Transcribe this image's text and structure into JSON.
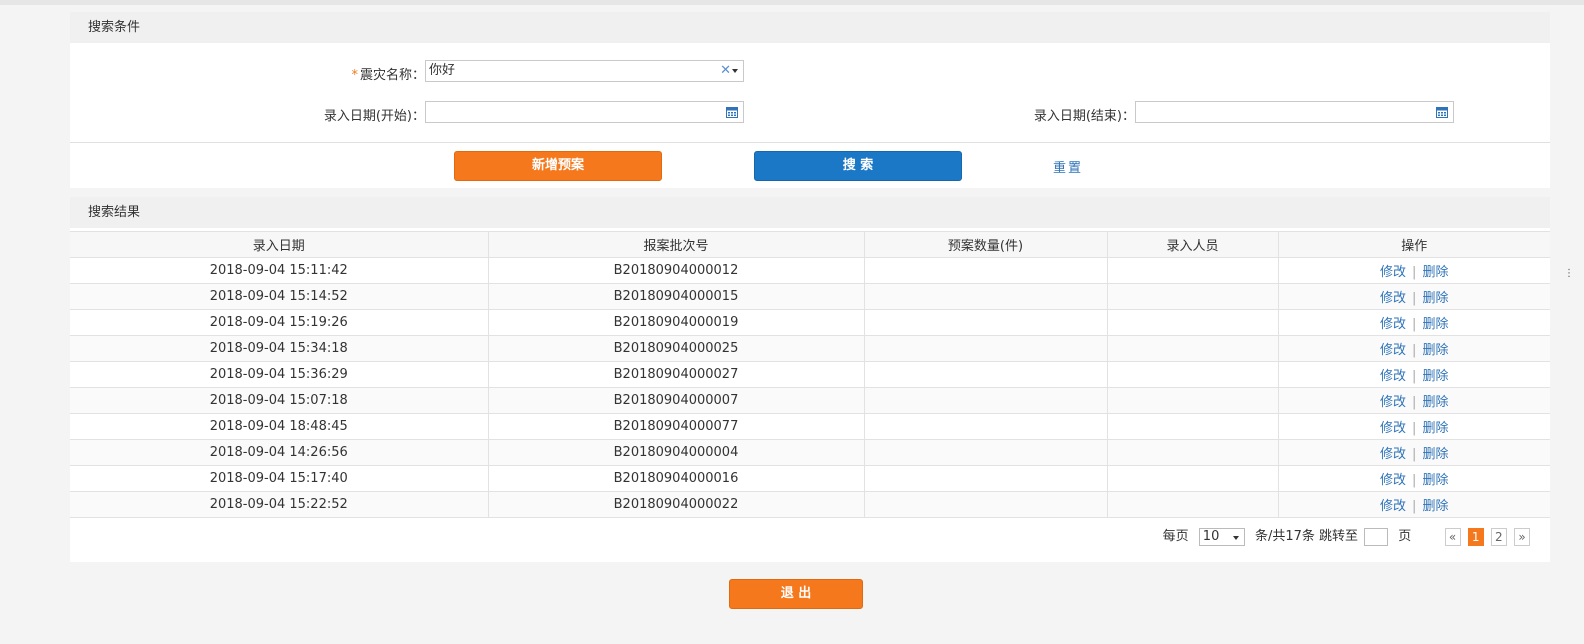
{
  "search": {
    "title": "搜索条件",
    "name_label": "震灾名称：",
    "name_required_mark": "*",
    "name_value": "你好",
    "date_start_label": "录入日期(开始)：",
    "date_start_value": "",
    "date_end_label": "录入日期(结束)：",
    "date_end_value": "",
    "add_button": "新增预案",
    "search_button": "搜 索",
    "reset_link": "重置"
  },
  "results": {
    "title": "搜索结果",
    "columns": [
      "录入日期",
      "报案批次号",
      "预案数量(件)",
      "录入人员",
      "操作"
    ],
    "rows": [
      {
        "date": "2018-09-04 15:11:42",
        "batch": "B20180904000012",
        "count": "",
        "user": ""
      },
      {
        "date": "2018-09-04 15:14:52",
        "batch": "B20180904000015",
        "count": "",
        "user": ""
      },
      {
        "date": "2018-09-04 15:19:26",
        "batch": "B20180904000019",
        "count": "",
        "user": ""
      },
      {
        "date": "2018-09-04 15:34:18",
        "batch": "B20180904000025",
        "count": "",
        "user": ""
      },
      {
        "date": "2018-09-04 15:36:29",
        "batch": "B20180904000027",
        "count": "",
        "user": ""
      },
      {
        "date": "2018-09-04 15:07:18",
        "batch": "B20180904000007",
        "count": "",
        "user": ""
      },
      {
        "date": "2018-09-04 18:48:45",
        "batch": "B20180904000077",
        "count": "",
        "user": ""
      },
      {
        "date": "2018-09-04 14:26:56",
        "batch": "B20180904000004",
        "count": "",
        "user": ""
      },
      {
        "date": "2018-09-04 15:17:40",
        "batch": "B20180904000016",
        "count": "",
        "user": ""
      },
      {
        "date": "2018-09-04 15:22:52",
        "batch": "B20180904000022",
        "count": "",
        "user": ""
      }
    ],
    "edit_label": "修改",
    "op_separator": "|",
    "delete_label": "删除"
  },
  "pager": {
    "per_page_label": "每页",
    "per_page_value": "10",
    "total_label": "条/共17条 跳转至",
    "page_label": "页",
    "prev": "«",
    "pages": [
      "1",
      "2"
    ],
    "current_page": "1",
    "next": "»"
  },
  "footer": {
    "exit_button": "退 出"
  },
  "colors": {
    "accent_orange": "#f5781c",
    "primary_blue": "#1b78c6",
    "link_blue": "#2f74b8"
  },
  "icons": [
    "clear-icon",
    "dropdown-caret-icon",
    "calendar-icon"
  ]
}
